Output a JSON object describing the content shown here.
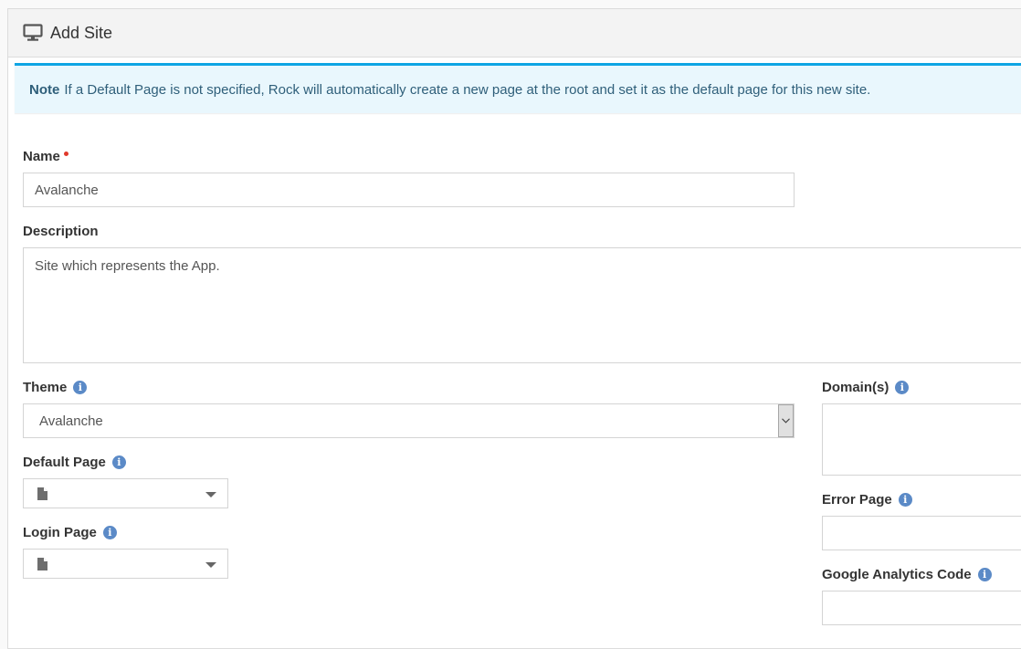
{
  "panel": {
    "title": "Add Site",
    "icon": "desktop-monitor-icon"
  },
  "alert": {
    "strong": "Note",
    "text": "If a Default Page is not specified, Rock will automatically create a new page at the root and set it as the default page for this new site.",
    "border_color": "#0ea5e4",
    "background": "#e9f7fd"
  },
  "form": {
    "name": {
      "label": "Name",
      "required": true,
      "value": "Avalanche"
    },
    "description": {
      "label": "Description",
      "value": "Site which represents the App."
    },
    "theme": {
      "label": "Theme",
      "selected": "Avalanche",
      "has_help": true
    },
    "default_page": {
      "label": "Default Page",
      "value": "",
      "has_help": true
    },
    "login_page": {
      "label": "Login Page",
      "value": "",
      "has_help": true
    },
    "domains": {
      "label": "Domain(s)",
      "value": "",
      "has_help": true
    },
    "error_page": {
      "label": "Error Page",
      "value": "",
      "has_help": true
    },
    "google_analytics": {
      "label": "Google Analytics Code",
      "value": "",
      "has_help": true
    }
  },
  "colors": {
    "required_dot": "#e0392b",
    "info_icon": "#5b8ac7"
  }
}
